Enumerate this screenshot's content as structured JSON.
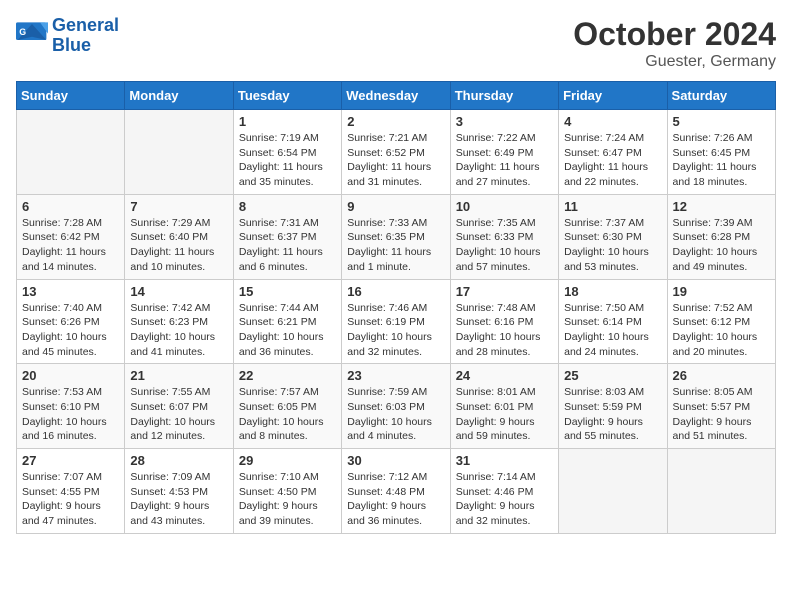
{
  "header": {
    "logo_line1": "General",
    "logo_line2": "Blue",
    "month_year": "October 2024",
    "location": "Guester, Germany"
  },
  "days_of_week": [
    "Sunday",
    "Monday",
    "Tuesday",
    "Wednesday",
    "Thursday",
    "Friday",
    "Saturday"
  ],
  "weeks": [
    [
      {
        "day": "",
        "info": ""
      },
      {
        "day": "",
        "info": ""
      },
      {
        "day": "1",
        "info": "Sunrise: 7:19 AM\nSunset: 6:54 PM\nDaylight: 11 hours\nand 35 minutes."
      },
      {
        "day": "2",
        "info": "Sunrise: 7:21 AM\nSunset: 6:52 PM\nDaylight: 11 hours\nand 31 minutes."
      },
      {
        "day": "3",
        "info": "Sunrise: 7:22 AM\nSunset: 6:49 PM\nDaylight: 11 hours\nand 27 minutes."
      },
      {
        "day": "4",
        "info": "Sunrise: 7:24 AM\nSunset: 6:47 PM\nDaylight: 11 hours\nand 22 minutes."
      },
      {
        "day": "5",
        "info": "Sunrise: 7:26 AM\nSunset: 6:45 PM\nDaylight: 11 hours\nand 18 minutes."
      }
    ],
    [
      {
        "day": "6",
        "info": "Sunrise: 7:28 AM\nSunset: 6:42 PM\nDaylight: 11 hours\nand 14 minutes."
      },
      {
        "day": "7",
        "info": "Sunrise: 7:29 AM\nSunset: 6:40 PM\nDaylight: 11 hours\nand 10 minutes."
      },
      {
        "day": "8",
        "info": "Sunrise: 7:31 AM\nSunset: 6:37 PM\nDaylight: 11 hours\nand 6 minutes."
      },
      {
        "day": "9",
        "info": "Sunrise: 7:33 AM\nSunset: 6:35 PM\nDaylight: 11 hours\nand 1 minute."
      },
      {
        "day": "10",
        "info": "Sunrise: 7:35 AM\nSunset: 6:33 PM\nDaylight: 10 hours\nand 57 minutes."
      },
      {
        "day": "11",
        "info": "Sunrise: 7:37 AM\nSunset: 6:30 PM\nDaylight: 10 hours\nand 53 minutes."
      },
      {
        "day": "12",
        "info": "Sunrise: 7:39 AM\nSunset: 6:28 PM\nDaylight: 10 hours\nand 49 minutes."
      }
    ],
    [
      {
        "day": "13",
        "info": "Sunrise: 7:40 AM\nSunset: 6:26 PM\nDaylight: 10 hours\nand 45 minutes."
      },
      {
        "day": "14",
        "info": "Sunrise: 7:42 AM\nSunset: 6:23 PM\nDaylight: 10 hours\nand 41 minutes."
      },
      {
        "day": "15",
        "info": "Sunrise: 7:44 AM\nSunset: 6:21 PM\nDaylight: 10 hours\nand 36 minutes."
      },
      {
        "day": "16",
        "info": "Sunrise: 7:46 AM\nSunset: 6:19 PM\nDaylight: 10 hours\nand 32 minutes."
      },
      {
        "day": "17",
        "info": "Sunrise: 7:48 AM\nSunset: 6:16 PM\nDaylight: 10 hours\nand 28 minutes."
      },
      {
        "day": "18",
        "info": "Sunrise: 7:50 AM\nSunset: 6:14 PM\nDaylight: 10 hours\nand 24 minutes."
      },
      {
        "day": "19",
        "info": "Sunrise: 7:52 AM\nSunset: 6:12 PM\nDaylight: 10 hours\nand 20 minutes."
      }
    ],
    [
      {
        "day": "20",
        "info": "Sunrise: 7:53 AM\nSunset: 6:10 PM\nDaylight: 10 hours\nand 16 minutes."
      },
      {
        "day": "21",
        "info": "Sunrise: 7:55 AM\nSunset: 6:07 PM\nDaylight: 10 hours\nand 12 minutes."
      },
      {
        "day": "22",
        "info": "Sunrise: 7:57 AM\nSunset: 6:05 PM\nDaylight: 10 hours\nand 8 minutes."
      },
      {
        "day": "23",
        "info": "Sunrise: 7:59 AM\nSunset: 6:03 PM\nDaylight: 10 hours\nand 4 minutes."
      },
      {
        "day": "24",
        "info": "Sunrise: 8:01 AM\nSunset: 6:01 PM\nDaylight: 9 hours\nand 59 minutes."
      },
      {
        "day": "25",
        "info": "Sunrise: 8:03 AM\nSunset: 5:59 PM\nDaylight: 9 hours\nand 55 minutes."
      },
      {
        "day": "26",
        "info": "Sunrise: 8:05 AM\nSunset: 5:57 PM\nDaylight: 9 hours\nand 51 minutes."
      }
    ],
    [
      {
        "day": "27",
        "info": "Sunrise: 7:07 AM\nSunset: 4:55 PM\nDaylight: 9 hours\nand 47 minutes."
      },
      {
        "day": "28",
        "info": "Sunrise: 7:09 AM\nSunset: 4:53 PM\nDaylight: 9 hours\nand 43 minutes."
      },
      {
        "day": "29",
        "info": "Sunrise: 7:10 AM\nSunset: 4:50 PM\nDaylight: 9 hours\nand 39 minutes."
      },
      {
        "day": "30",
        "info": "Sunrise: 7:12 AM\nSunset: 4:48 PM\nDaylight: 9 hours\nand 36 minutes."
      },
      {
        "day": "31",
        "info": "Sunrise: 7:14 AM\nSunset: 4:46 PM\nDaylight: 9 hours\nand 32 minutes."
      },
      {
        "day": "",
        "info": ""
      },
      {
        "day": "",
        "info": ""
      }
    ]
  ]
}
